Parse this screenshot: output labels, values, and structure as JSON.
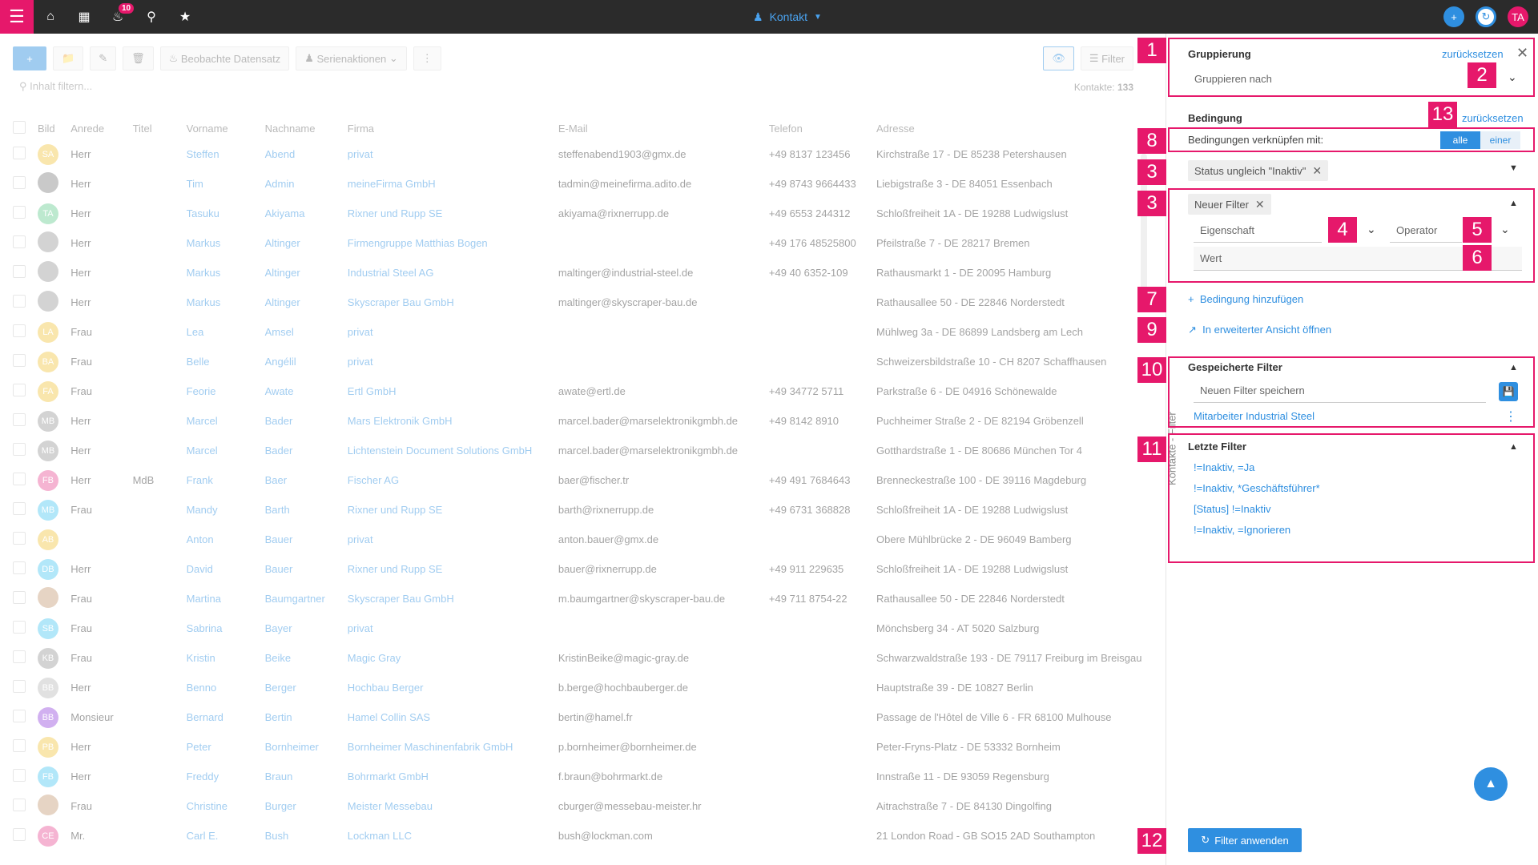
{
  "topbar": {
    "notification_count": "10",
    "title": "Kontakt",
    "user_initials": "TA"
  },
  "toolbar": {
    "observe_label": "Beobachte Datensatz",
    "bulk_label": "Serienaktionen",
    "filter_label": "Filter"
  },
  "search": {
    "placeholder": "Inhalt filtern..."
  },
  "contacts_count_label": "Kontakte:",
  "contacts_count": "133",
  "table": {
    "headers": [
      "Bild",
      "Anrede",
      "Titel",
      "Vorname",
      "Nachname",
      "Firma",
      "E-Mail",
      "Telefon",
      "Adresse"
    ],
    "rows": [
      {
        "initials": "SA",
        "color": "#f2c94c",
        "anrede": "Herr",
        "titel": "",
        "vorname": "Steffen",
        "nachname": "Abend",
        "firma": "privat",
        "email": "steffenabend1903@gmx.de",
        "telefon": "+49 8137 123456",
        "adresse": "Kirchstraße 17 - DE 85238 Petershausen"
      },
      {
        "initials": "",
        "color": "#8a8a8a",
        "anrede": "Herr",
        "titel": "",
        "vorname": "Tim",
        "nachname": "Admin",
        "firma": "meineFirma GmbH",
        "email": "tadmin@meinefirma.adito.de",
        "telefon": "+49 8743 9664433",
        "adresse": "Liebigstraße 3 - DE 84051 Essenbach"
      },
      {
        "initials": "TA",
        "color": "#6fcf97",
        "anrede": "Herr",
        "titel": "",
        "vorname": "Tasuku",
        "nachname": "Akiyama",
        "firma": "Rixner und Rupp SE",
        "email": "akiyama@rixnerrupp.de",
        "telefon": "+49 6553 244312",
        "adresse": "Schloßfreiheit 1A - DE 19288 Ludwigslust"
      },
      {
        "initials": "",
        "color": "#a0a0a0",
        "anrede": "Herr",
        "titel": "",
        "vorname": "Markus",
        "nachname": "Altinger",
        "firma": "Firmengruppe Matthias Bogen",
        "email": "",
        "telefon": "+49 176 48525800",
        "adresse": "Pfeilstraße 7 - DE 28217 Bremen"
      },
      {
        "initials": "",
        "color": "#a0a0a0",
        "anrede": "Herr",
        "titel": "",
        "vorname": "Markus",
        "nachname": "Altinger",
        "firma": "Industrial Steel AG",
        "email": "maltinger@industrial-steel.de",
        "telefon": "+49 40 6352-109",
        "adresse": "Rathausmarkt 1 - DE 20095 Hamburg"
      },
      {
        "initials": "",
        "color": "#a0a0a0",
        "anrede": "Herr",
        "titel": "",
        "vorname": "Markus",
        "nachname": "Altinger",
        "firma": "Skyscraper Bau GmbH",
        "email": "maltinger@skyscraper-bau.de",
        "telefon": "",
        "adresse": "Rathausallee 50 - DE 22846 Norderstedt"
      },
      {
        "initials": "LA",
        "color": "#f2c94c",
        "anrede": "Frau",
        "titel": "",
        "vorname": "Lea",
        "nachname": "Amsel",
        "firma": "privat",
        "email": "",
        "telefon": "",
        "adresse": "Mühlweg 3a - DE 86899 Landsberg am Lech"
      },
      {
        "initials": "BA",
        "color": "#f2c94c",
        "anrede": "Frau",
        "titel": "",
        "vorname": "Belle",
        "nachname": "Angélil",
        "firma": "privat",
        "email": "",
        "telefon": "",
        "adresse": "Schweizersbildstraße 10 - CH 8207 Schaffhausen"
      },
      {
        "initials": "FA",
        "color": "#f2c94c",
        "anrede": "Frau",
        "titel": "",
        "vorname": "Feorie",
        "nachname": "Awate",
        "firma": "Ertl GmbH",
        "email": "awate@ertl.de",
        "telefon": "+49 34772 5711",
        "adresse": "Parkstraße 6 - DE 04916 Schönewalde"
      },
      {
        "initials": "MB",
        "color": "#9e9e9e",
        "anrede": "Herr",
        "titel": "",
        "vorname": "Marcel",
        "nachname": "Bader",
        "firma": "Mars Elektronik GmbH",
        "email": "marcel.bader@marselektronikgmbh.de",
        "telefon": "+49 8142 8910",
        "adresse": "Puchheimer Straße 2 - DE 82194 Gröbenzell"
      },
      {
        "initials": "MB",
        "color": "#9e9e9e",
        "anrede": "Herr",
        "titel": "",
        "vorname": "Marcel",
        "nachname": "Bader",
        "firma": "Lichtenstein Document Solutions GmbH",
        "email": "marcel.bader@marselektronikgmbh.de",
        "telefon": "",
        "adresse": "Gotthardstraße 1 - DE 80686 München Tor 4"
      },
      {
        "initials": "FB",
        "color": "#eb5b9d",
        "anrede": "Herr",
        "titel": "MdB",
        "vorname": "Frank",
        "nachname": "Baer",
        "firma": "Fischer AG",
        "email": "baer@fischer.tr",
        "telefon": "+49 491 7684643",
        "adresse": "Brenneckestraße 100 - DE 39116 Magdeburg"
      },
      {
        "initials": "MB",
        "color": "#56ccf2",
        "anrede": "Frau",
        "titel": "",
        "vorname": "Mandy",
        "nachname": "Barth",
        "firma": "Rixner und Rupp SE",
        "email": "barth@rixnerrupp.de",
        "telefon": "+49 6731 368828",
        "adresse": "Schloßfreiheit 1A - DE 19288 Ludwigslust"
      },
      {
        "initials": "AB",
        "color": "#f2c94c",
        "anrede": "",
        "titel": "",
        "vorname": "Anton",
        "nachname": "Bauer",
        "firma": "privat",
        "email": "anton.bauer@gmx.de",
        "telefon": "",
        "adresse": "Obere Mühlbrücke 2 - DE 96049 Bamberg"
      },
      {
        "initials": "DB",
        "color": "#56ccf2",
        "anrede": "Herr",
        "titel": "",
        "vorname": "David",
        "nachname": "Bauer",
        "firma": "Rixner und Rupp SE",
        "email": "bauer@rixnerrupp.de",
        "telefon": "+49 911 229635",
        "adresse": "Schloßfreiheit 1A - DE 19288 Ludwigslust"
      },
      {
        "initials": "",
        "color": "#c9a27e",
        "anrede": "Frau",
        "titel": "",
        "vorname": "Martina",
        "nachname": "Baumgartner",
        "firma": "Skyscraper Bau GmbH",
        "email": "m.baumgartner@skyscraper-bau.de",
        "telefon": "+49 711 8754-22",
        "adresse": "Rathausallee 50 - DE 22846 Norderstedt"
      },
      {
        "initials": "SB",
        "color": "#56ccf2",
        "anrede": "Frau",
        "titel": "",
        "vorname": "Sabrina",
        "nachname": "Bayer",
        "firma": "privat",
        "email": "",
        "telefon": "",
        "adresse": "Mönchsberg 34 - AT 5020 Salzburg"
      },
      {
        "initials": "KB",
        "color": "#9e9e9e",
        "anrede": "Frau",
        "titel": "",
        "vorname": "Kristin",
        "nachname": "Beike",
        "firma": "Magic Gray",
        "email": "KristinBeike@magic-gray.de",
        "telefon": "",
        "adresse": "Schwarzwaldstraße 193 - DE 79117 Freiburg im Breisgau"
      },
      {
        "initials": "BB",
        "color": "#bdbdbd",
        "anrede": "Herr",
        "titel": "",
        "vorname": "Benno",
        "nachname": "Berger",
        "firma": "Hochbau Berger",
        "email": "b.berge@hochbauberger.de",
        "telefon": "",
        "adresse": "Hauptstraße 39 - DE 10827 Berlin"
      },
      {
        "initials": "BB",
        "color": "#9b51e0",
        "anrede": "Monsieur",
        "titel": "",
        "vorname": "Bernard",
        "nachname": "Bertin",
        "firma": "Hamel Collin SAS",
        "email": "bertin@hamel.fr",
        "telefon": "",
        "adresse": "Passage de l'Hôtel de Ville 6 - FR 68100 Mulhouse"
      },
      {
        "initials": "PB",
        "color": "#f2c94c",
        "anrede": "Herr",
        "titel": "",
        "vorname": "Peter",
        "nachname": "Bornheimer",
        "firma": "Bornheimer Maschinenfabrik GmbH",
        "email": "p.bornheimer@bornheimer.de",
        "telefon": "",
        "adresse": "Peter-Fryns-Platz - DE 53332 Bornheim"
      },
      {
        "initials": "FB",
        "color": "#56ccf2",
        "anrede": "Herr",
        "titel": "",
        "vorname": "Freddy",
        "nachname": "Braun",
        "firma": "Bohrmarkt GmbH",
        "email": "f.braun@bohrmarkt.de",
        "telefon": "",
        "adresse": "Innstraße 11 - DE 93059 Regensburg"
      },
      {
        "initials": "",
        "color": "#c9a27e",
        "anrede": "Frau",
        "titel": "",
        "vorname": "Christine",
        "nachname": "Burger",
        "firma": "Meister Messebau",
        "email": "cburger@messebau-meister.hr",
        "telefon": "",
        "adresse": "Aitrachstraße 7 - DE 84130 Dingolfing"
      },
      {
        "initials": "CE",
        "color": "#eb5b9d",
        "anrede": "Mr.",
        "titel": "",
        "vorname": "Carl E.",
        "nachname": "Bush",
        "firma": "Lockman LLC",
        "email": "bush@lockman.com",
        "telefon": "",
        "adresse": "21 London Road - GB SO15 2AD Southampton"
      }
    ]
  },
  "panel": {
    "side_tab": "Kontakte - Filter",
    "grouping": {
      "title": "Gruppierung",
      "reset": "zurücksetzen",
      "placeholder": "Gruppieren nach"
    },
    "condition": {
      "title": "Bedingung",
      "reset": "zurücksetzen",
      "link_label": "Bedingungen verknüpfen mit:",
      "toggle_all": "alle",
      "toggle_one": "einer",
      "existing_chip": "Status ungleich \"Inaktiv\"",
      "new_chip": "Neuer Filter",
      "property_placeholder": "Eigenschaft",
      "operator_placeholder": "Operator",
      "value_placeholder": "Wert",
      "add_condition": "Bedingung hinzufügen",
      "open_extended": "In erweiterter Ansicht öffnen"
    },
    "saved": {
      "title": "Gespeicherte Filter",
      "new_placeholder": "Neuen Filter speichern",
      "items": [
        "Mitarbeiter Industrial Steel"
      ]
    },
    "recent": {
      "title": "Letzte Filter",
      "items": [
        "!=Inaktiv, =Ja",
        "!=Inaktiv, *Geschäftsführer*",
        "[Status] !=Inaktiv",
        "!=Inaktiv, =Ignorieren"
      ]
    },
    "apply": "Filter anwenden"
  },
  "markers": [
    "1",
    "2",
    "3",
    "3",
    "4",
    "5",
    "6",
    "7",
    "8",
    "9",
    "10",
    "11",
    "12",
    "13"
  ],
  "colors": {
    "accent": "#e6186b",
    "primary": "#2f8fe0",
    "topbar": "#2b2b2b"
  }
}
